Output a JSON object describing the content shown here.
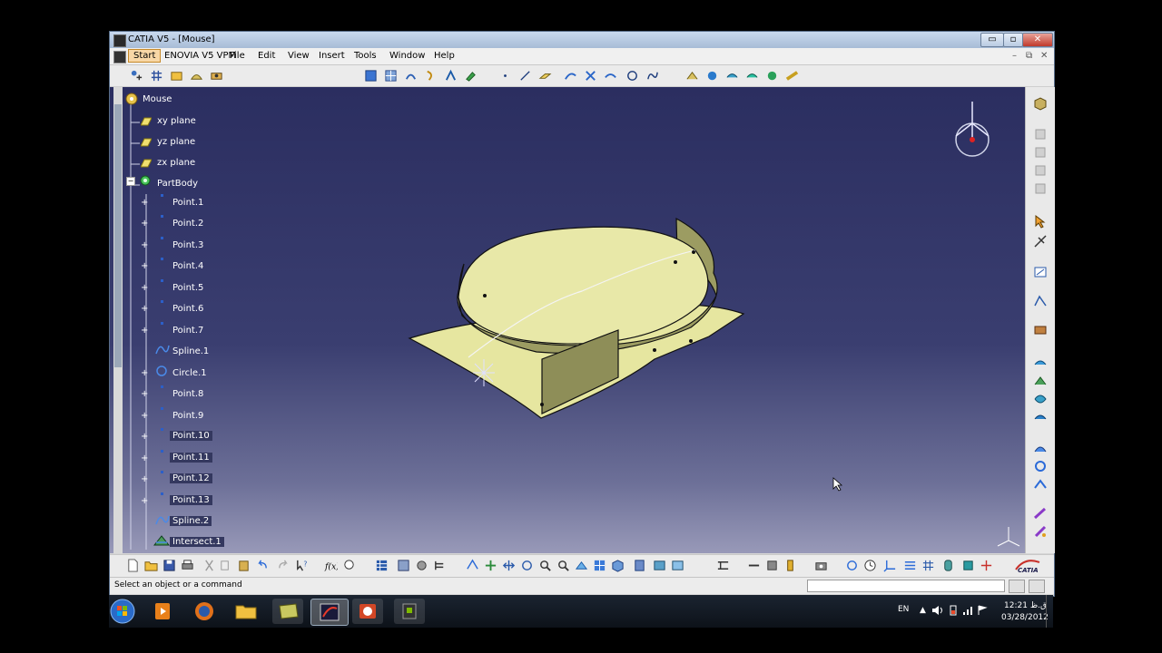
{
  "window": {
    "title": "CATIA V5 - [Mouse]",
    "controls": {
      "minimize": "▭",
      "maximize": "▫",
      "close": "✕"
    }
  },
  "menubar": {
    "items": [
      "Start",
      "ENOVIA V5 VPM",
      "File",
      "Edit",
      "View",
      "Insert",
      "Tools",
      "Window",
      "Help"
    ],
    "doc_controls": {
      "minimize": "–",
      "restore": "⧉",
      "close": "✕"
    }
  },
  "tree": {
    "root": "Mouse",
    "planes": [
      "xy plane",
      "yz plane",
      "zx plane"
    ],
    "body": "PartBody",
    "children": [
      {
        "label": "Point.1",
        "type": "point",
        "selected": false
      },
      {
        "label": "Point.2",
        "type": "point",
        "selected": false
      },
      {
        "label": "Point.3",
        "type": "point",
        "selected": false
      },
      {
        "label": "Point.4",
        "type": "point",
        "selected": false
      },
      {
        "label": "Point.5",
        "type": "point",
        "selected": false
      },
      {
        "label": "Point.6",
        "type": "point",
        "selected": false
      },
      {
        "label": "Point.7",
        "type": "point",
        "selected": false
      },
      {
        "label": "Spline.1",
        "type": "spline",
        "selected": false
      },
      {
        "label": "Circle.1",
        "type": "circle",
        "selected": false
      },
      {
        "label": "Point.8",
        "type": "point",
        "selected": false
      },
      {
        "label": "Point.9",
        "type": "point",
        "selected": false
      },
      {
        "label": "Point.10",
        "type": "point",
        "selected": false
      },
      {
        "label": "Point.11",
        "type": "point",
        "selected": true
      },
      {
        "label": "Point.12",
        "type": "point",
        "selected": true
      },
      {
        "label": "Point.13",
        "type": "point",
        "selected": true
      },
      {
        "label": "Spline.2",
        "type": "spline",
        "selected": true
      },
      {
        "label": "Intersect.1",
        "type": "intersect",
        "selected": true
      }
    ]
  },
  "statusbar": {
    "message": "Select an object or a command",
    "command_value": ""
  },
  "brand": {
    "logo_text": "CATIA"
  },
  "taskbar": {
    "language": "EN",
    "time": "12:21 ق.ظ",
    "date": "03/28/2012",
    "apps": [
      "start-orb",
      "media-player",
      "firefox",
      "explorer",
      "notepad-app",
      "catia",
      "office-powerpoint",
      "other-app"
    ]
  },
  "colors": {
    "viewport_top": "#2b2e60",
    "viewport_bottom": "#9899b8",
    "surface_fill": "#e8e8a8",
    "surface_edge": "#1a1a1a",
    "title_gradient": "#a7bcd6",
    "start_highlight": "#f8d7a6"
  }
}
